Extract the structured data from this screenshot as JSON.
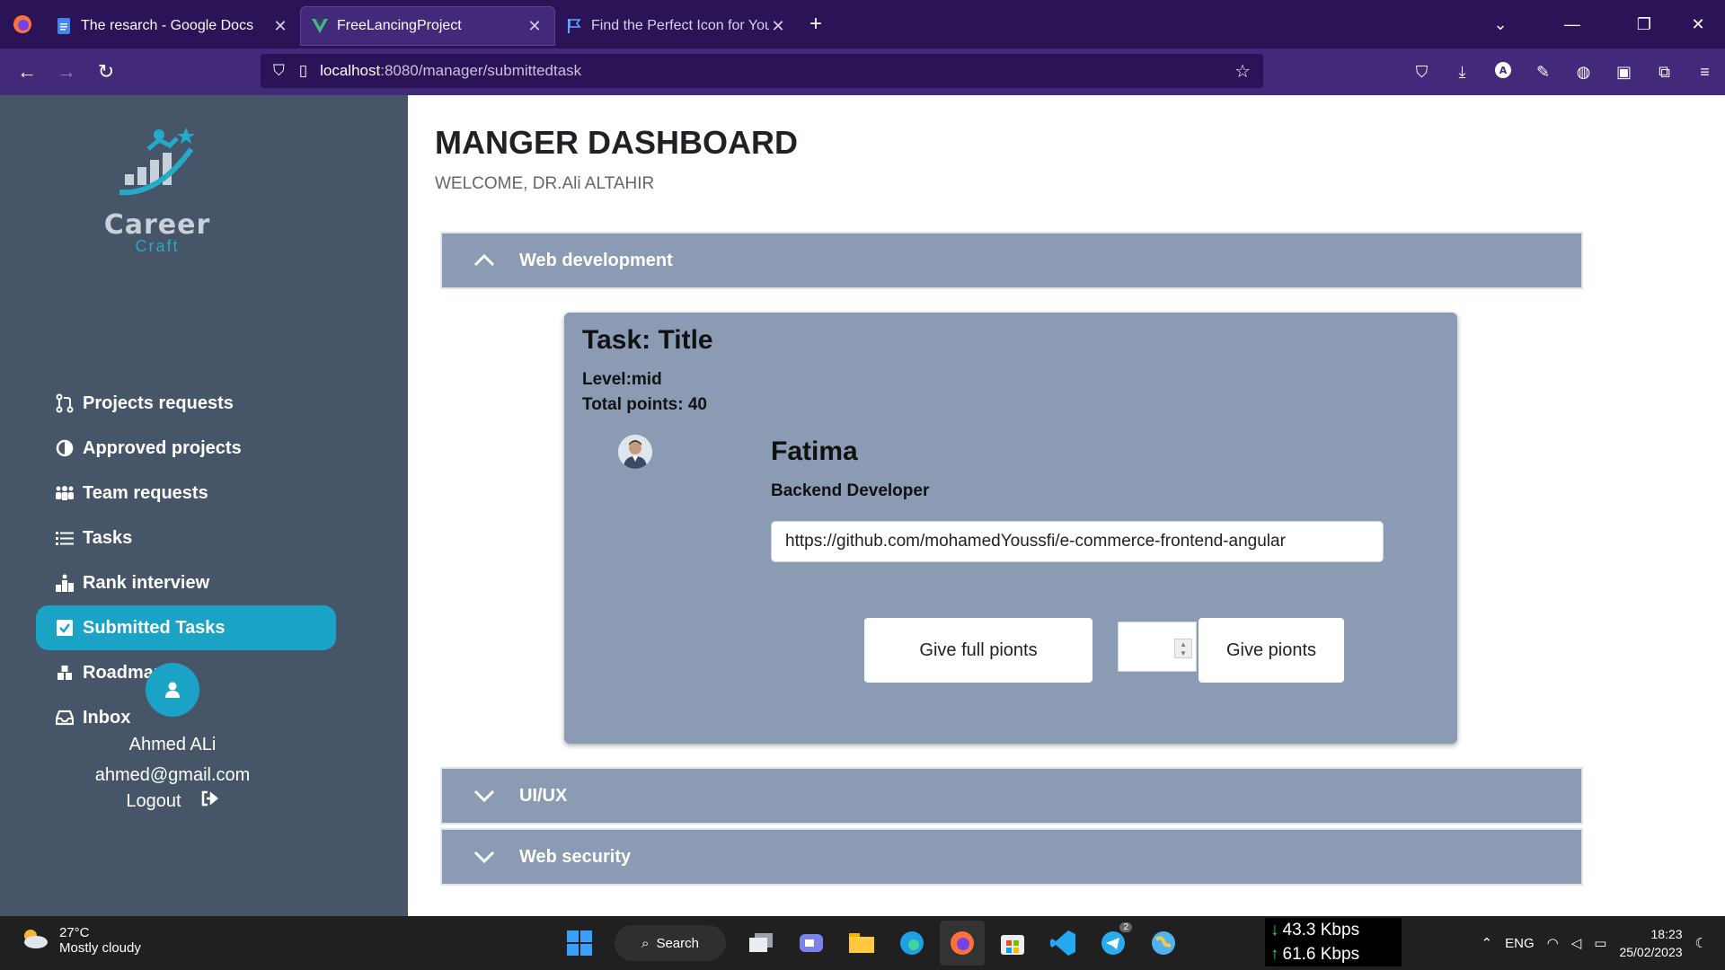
{
  "browser": {
    "tabs": [
      {
        "label": "The resarch - Google Docs",
        "icon": "google-docs-icon"
      },
      {
        "label": "FreeLancingProject",
        "icon": "vue-icon"
      },
      {
        "label": "Find the Perfect Icon for Your Pr",
        "icon": "flag-icon"
      }
    ],
    "url_host": "localhost",
    "url_path": ":8080/manager/submittedtask"
  },
  "sidebar": {
    "logo_word": "Career",
    "logo_sub": "Craft",
    "menu": [
      {
        "label": "Projects requests",
        "icon": "pull-request-icon"
      },
      {
        "label": "Approved projects",
        "icon": "half-circle-icon"
      },
      {
        "label": "Team requests",
        "icon": "users-icon"
      },
      {
        "label": "Tasks",
        "icon": "list-icon"
      },
      {
        "label": "Rank interview",
        "icon": "podium-icon"
      },
      {
        "label": "Submitted Tasks",
        "icon": "check-square-icon",
        "active": true
      },
      {
        "label": "Roadmaps",
        "icon": "boxes-icon"
      },
      {
        "label": "Inbox",
        "icon": "inbox-icon"
      }
    ],
    "user": {
      "name": "Ahmed ALi",
      "email": "ahmed@gmail.com",
      "logout": "Logout"
    }
  },
  "main": {
    "title": "MANGER DASHBOARD",
    "welcome": "WELCOME, DR.Ali ALTAHIR",
    "sections": [
      {
        "label": "Web development",
        "expanded": true
      },
      {
        "label": "UI/UX",
        "expanded": false
      },
      {
        "label": "Web security",
        "expanded": false
      }
    ],
    "task": {
      "title": "Task: Title",
      "level": "Level:mid",
      "total_points": "Total points: 40",
      "submitter_name": "Fatima",
      "submitter_role": "Backend Developer",
      "link": "https://github.com/mohamedYoussfi/e-commerce-frontend-angular",
      "full_points_label": "Give full pionts",
      "points_label": "Give pionts"
    }
  },
  "taskbar": {
    "temp": "27°C",
    "weather": "Mostly cloudy",
    "search": "Search",
    "down_speed": "43.3 Kbps",
    "up_speed": "61.6 Kbps",
    "lang": "ENG",
    "time": "18:23",
    "date": "25/02/2023",
    "badge": "2"
  },
  "colors": {
    "sidebar_bg": "#465567",
    "accent": "#1aa3c4",
    "card_bg": "#8a9bb3",
    "browser_bg": "#2b1357"
  }
}
